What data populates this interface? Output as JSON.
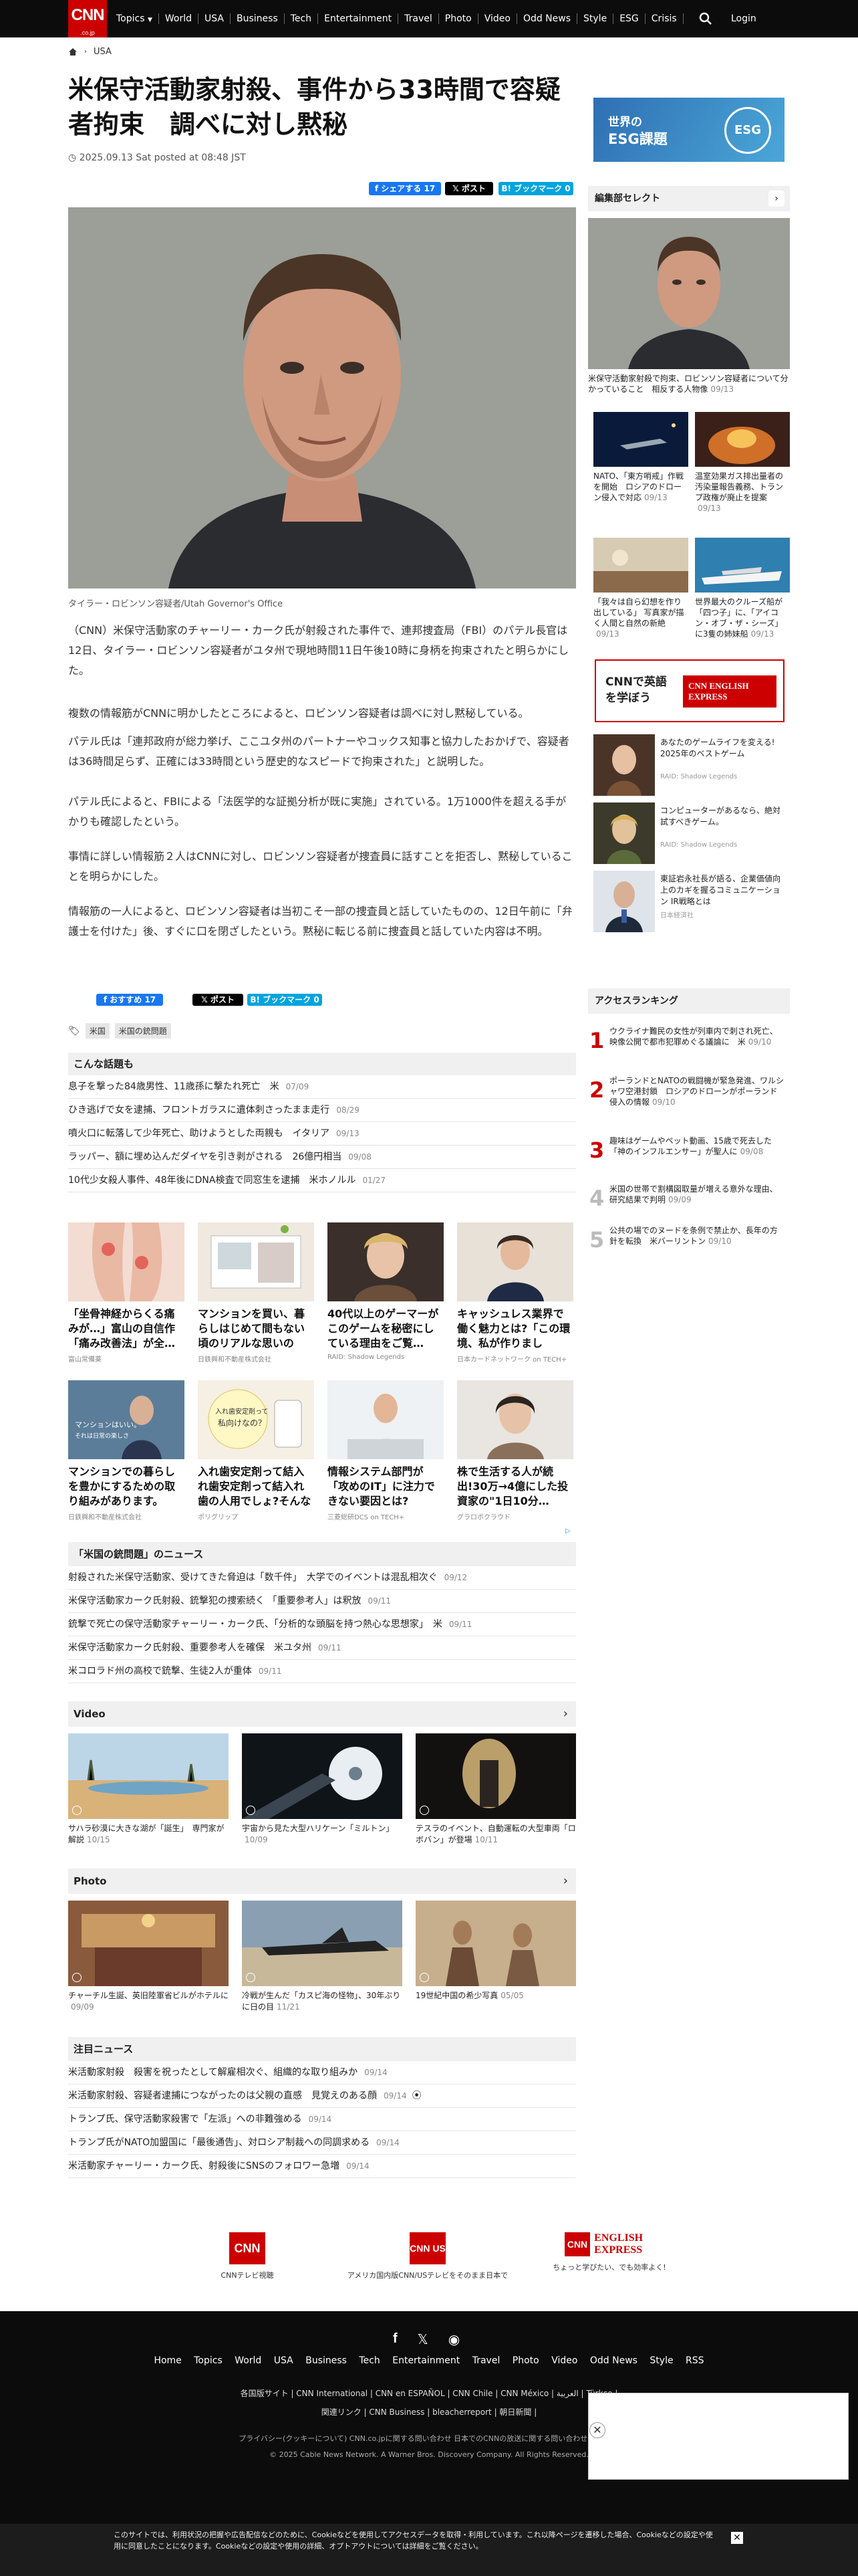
{
  "nav": {
    "logo": "CNN",
    "logo_sub": ".co.jp",
    "items": [
      "Topics",
      "World",
      "USA",
      "Business",
      "Tech",
      "Entertainment",
      "Travel",
      "Photo",
      "Video",
      "Odd News",
      "Style",
      "ESG",
      "Crisis"
    ],
    "login": "Login"
  },
  "breadcrumb": {
    "current": "USA"
  },
  "article": {
    "title": "米保守活動家射殺、事件から33時間で容疑者拘束　調べに対し黙秘",
    "posted": "2025.09.13 Sat posted at 08:48 JST",
    "share": {
      "facebook": "シェアする 17",
      "x": "ポスト",
      "hatena": "ブックマーク 0"
    },
    "image_credit": "タイラー・ロビンソン容疑者/Utah Governor's Office",
    "paragraphs": [
      "（CNN）米保守活動家のチャーリー・カーク氏が射殺された事件で、連邦捜査局（FBI）のパテル長官は12日、タイラー・ロビンソン容疑者がユタ州で現地時間11日午後10時に身柄を拘束されたと明らかにした。",
      "複数の情報筋がCNNに明かしたところによると、ロビンソン容疑者は調べに対し黙秘している。",
      "パテル氏は「連邦政府が総力挙げ、ここユタ州のパートナーやコックス知事と協力したおかげで、容疑者は36時間足らず、正確には33時間という歴史的なスピードで拘束された」と説明した。",
      "パテル氏によると、FBIによる「法医学的な証拠分析が既に実施」されている。1万1000件を超える手がかりも確認したという。",
      "事情に詳しい情報筋２人はCNNに対し、ロビンソン容疑者が捜査員に話すことを拒否し、黙秘していることを明らかにした。",
      "情報筋の一人によると、ロビンソン容疑者は当初こそ一部の捜査員と話していたものの、12日午前に「弁護士を付けた」後、すぐに口を閉ざしたという。黙秘に転じる前に捜査員と話していた内容は不明。"
    ],
    "share_bottom": {
      "facebook": "おすすめ 17",
      "x": "ポスト",
      "hatena": "ブックマーク 0"
    },
    "tags": [
      "米国",
      "米国の銃問題"
    ]
  },
  "related": {
    "title": "こんな話題も",
    "items": [
      {
        "text": "息子を撃った84歳男性、11歳孫に撃たれ死亡　米",
        "date": "07/09"
      },
      {
        "text": "ひき逃げで女を逮捕、フロントガラスに遺体刺さったまま走行",
        "date": "08/29"
      },
      {
        "text": "噴火口に転落して少年死亡、助けようとした両親も　イタリア",
        "date": "09/13"
      },
      {
        "text": "ラッパー、額に埋め込んだダイヤを引き剥がされる　26億円相当",
        "date": "09/08"
      },
      {
        "text": "10代少女殺人事件、48年後にDNA検査で同窓生を逮捕　米ホノルル",
        "date": "01/27"
      }
    ]
  },
  "ads": [
    {
      "title": "「坐骨神経からくる痛みが…」富山の自信作「痛み改善法」が全…",
      "source": "富山常備薬"
    },
    {
      "title": "マンションを買い、暮らしはじめて間もない頃のリアルな思いのス…",
      "source": "日鉄興和不動産株式会社"
    },
    {
      "title": "40代以上のゲーマーがこのゲームを秘密にしている理由をご覧…",
      "source": "RAID: Shadow Legends"
    },
    {
      "title": "キャッシュレス業界で働く魅力とは?「この環境、私が作りました」…",
      "source": "日本カードネットワーク on TECH+"
    },
    {
      "title": "マンションでの暮らしを豊かにするための取り組みがあります。",
      "source": "日鉄興和不動産株式会社"
    },
    {
      "title": "入れ歯安定剤って結入れ歯安定剤って結入れ歯の人用でしょ?そんな部分入れ歯の…",
      "source": "ポリグリップ"
    },
    {
      "title": "情報システム部門が「攻めのIT」に注力できない要因とは?",
      "source": "三菱総研DCS on TECH+"
    },
    {
      "title": "株で生活する人が続出!30万→4億にした投資家の\"1日10分…",
      "source": "グラロボクラウド"
    }
  ],
  "ad_banner1": {
    "line1": "マンションはいい。",
    "line2": "それは日常の楽しさ"
  },
  "ad_banner2": {
    "line1": "入れ歯安定剤って",
    "line2": "私向けなの？"
  },
  "usgun": {
    "title": "「米国の銃問題」のニュース",
    "items": [
      {
        "text": "射殺された米保守活動家、受けてきた脅迫は「数千件」　大学でのイベントは混乱相次ぐ",
        "date": "09/12"
      },
      {
        "text": "米保守活動家カーク氏射殺、銃撃犯の捜索続く 「重要参考人」は釈放",
        "date": "09/11"
      },
      {
        "text": "銃撃で死亡の保守活動家チャーリー・カーク氏、「分析的な頭脳を持つ熱心な思想家」　米",
        "date": "09/11"
      },
      {
        "text": "米保守活動家カーク氏射殺、重要参考人を確保　米ユタ州",
        "date": "09/11"
      },
      {
        "text": "米コロラド州の高校で銃撃、生徒2人が重体",
        "date": "09/11"
      }
    ]
  },
  "video": {
    "title": "Video",
    "items": [
      {
        "text": "サハラ砂漠に大きな湖が「誕生」　専門家が解説",
        "date": "10/15"
      },
      {
        "text": "宇宙から見た大型ハリケーン「ミルトン」",
        "date": "10/09"
      },
      {
        "text": "テスラのイベント、自動運転の大型車両「ロボバン」が登場",
        "date": "10/11"
      }
    ]
  },
  "photo": {
    "title": "Photo",
    "items": [
      {
        "text": "チャーチル生誕、英旧陸軍省ビルがホテルに",
        "date": "09/09"
      },
      {
        "text": "冷戦が生んだ「カスピ海の怪物」、30年ぶりに日の目",
        "date": "11/21"
      },
      {
        "text": "19世紀中国の希少写真",
        "date": "05/05"
      }
    ]
  },
  "featured": {
    "title": "注目ニュース",
    "items": [
      {
        "text": "米活動家射殺　殺害を祝ったとして解雇相次ぐ、組織的な取り組みか",
        "date": "09/14"
      },
      {
        "text": "米活動家射殺、容疑者逮捕につながったのは父親の直感　見覚えのある顔",
        "date": "09/14"
      },
      {
        "text": "トランプ氏、保守活動家殺害で「左派」への非難強める",
        "date": "09/14"
      },
      {
        "text": "トランプ氏がNATO加盟国に「最後通告」、対ロシア制裁への同調求める",
        "date": "09/14"
      },
      {
        "text": "米活動家チャーリー・カーク氏、射殺後にSNSのフォロワー急増",
        "date": "09/14"
      }
    ]
  },
  "sidebar": {
    "banner": {
      "line1": "世界の",
      "line2": "ESG課題",
      "badge": "ESG"
    },
    "editors_title": "編集部セレクト",
    "lead": {
      "text": "米保守活動家射殺で拘束、ロビンソン容疑者について分かっていること　相反する人物像",
      "date": "09/13"
    },
    "thumbs": [
      {
        "text": "NATO、「東方哨戒」作戦を開始　ロシアのドローン侵入で対応",
        "date": "09/13"
      },
      {
        "text": "温室効果ガス排出量者の汚染量報告義務、トランプ政権が廃止を提案",
        "date": "09/13"
      },
      {
        "text": "「我々は自ら幻想を作り出している」 写真家が描く人間と自然の新絶",
        "date": "09/13"
      },
      {
        "text": "世界最大のクルーズ船が「四つ子」に、「アイコン・オブ・ザ・シーズ」に3隻の姉妹船",
        "date": "09/13"
      }
    ],
    "english": {
      "text": "CNNで英語を学ぼう",
      "brand": "CNN ENGLISH EXPRESS"
    },
    "pr": [
      {
        "text": "あなたのゲームライフを変える! 2025年のベストゲーム",
        "source": "RAID: Shadow Legends"
      },
      {
        "text": "コンピューターがあるなら、絶対試すべきゲーム。",
        "source": "RAID: Shadow Legends"
      },
      {
        "text": "東証岩永社長が語る、企業価値向上のカギを握るコミュニケーション IR戦略とは",
        "source": "日本経済社"
      }
    ],
    "ranking_title": "アクセスランキング",
    "ranking": [
      {
        "n": "1",
        "text": "ウクライナ難民の女性が列車内で刺され死亡、映像公開で都市犯罪めぐる議論に　米",
        "date": "09/10"
      },
      {
        "n": "2",
        "text": "ポーランドとNATOの戦闘機が緊急発進、ワルシャワ空港封鎖　ロシアのドローンがポーランド侵入の情報",
        "date": "09/10"
      },
      {
        "n": "3",
        "text": "趣味はゲームやペット動画、15歳で死去した「神のインフルエンサー」が聖人に",
        "date": "09/08"
      },
      {
        "n": "4",
        "text": "米国の世帯で割構図取量が増える意外な理由、研究結果で判明",
        "date": "09/09"
      },
      {
        "n": "5",
        "text": "公共の場でのヌードを条例で禁止か、長年の方針を転換　米バーリントン",
        "date": "09/10"
      }
    ]
  },
  "footer_logos": [
    {
      "box": "CNN",
      "label": "CNNテレビ視聴"
    },
    {
      "box": "CNN US",
      "label": "アメリカ国内版CNN/USテレビをそのまま日本で"
    },
    {
      "box": "CNN",
      "label": "ちょっと学びたい、でも効率よく!",
      "brand": "ENGLISH EXPRESS"
    }
  ],
  "footer": {
    "nav": [
      "Home",
      "Topics",
      "World",
      "USA",
      "Business",
      "Tech",
      "Entertainment",
      "Travel",
      "Photo",
      "Video",
      "Odd News",
      "Style",
      "RSS"
    ],
    "line1": "各国版サイト  |  CNN International  |  CNN en ESPAÑOL  |  CNN Chile  |  CNN México  |  العربية  |  Türkçe  |",
    "line2": "関連リンク  |  CNN Business  |  bleacherreport  |  朝日新聞  |",
    "line3": "プライバシー(クッキーについて)    CNN.co.jpに関する問い合わせ    日本でのCNNの放送に関する問い合わせ    広告掲載",
    "copyright": "© 2025 Cable News Network. A Warner Bros. Discovery Company. All Rights Reserved."
  },
  "cookie": {
    "text": "このサイトでは、利用状況の把握や広告配信などのために、Cookieなどを使用してアクセスデータを取得・利用しています。これ以降ページを遷移した場合、Cookieなどの設定や使用に同意したことになります。Cookieなどの設定や使用の詳細、オプトアウトについては詳細をご覧ください。"
  }
}
